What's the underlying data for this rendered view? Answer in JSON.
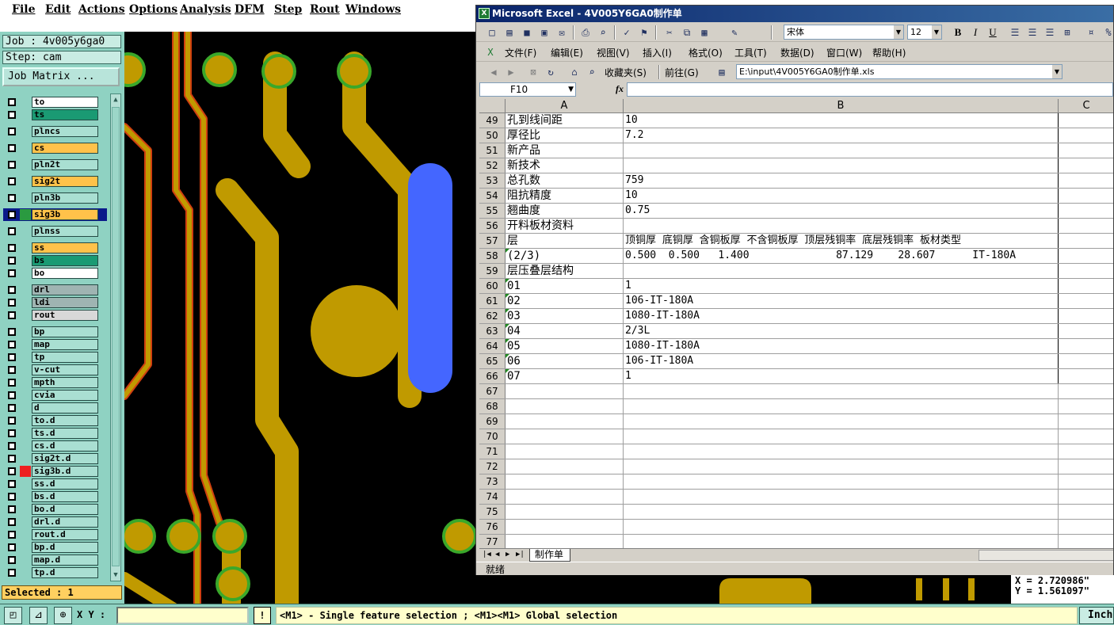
{
  "cam": {
    "menu": [
      "File",
      "Edit",
      "Actions",
      "Options",
      "Analysis",
      "DFM",
      "Step",
      "Rout",
      "Windows"
    ],
    "job_label": "Job : 4v005y6ga0",
    "step_label": "Step: cam",
    "job_matrix": "Job Matrix ...",
    "selected": "Selected : 1",
    "layers": [
      {
        "name": "to",
        "color": "#ffffff"
      },
      {
        "name": "ts",
        "color": "#1a9a73"
      },
      {
        "name": "plncs",
        "color": "#a9dfd2"
      },
      {
        "name": "cs",
        "color": "#ffc24a"
      },
      {
        "name": "pln2t",
        "color": "#a9dfd2"
      },
      {
        "name": "sig2t",
        "color": "#ffc24a"
      },
      {
        "name": "pln3b",
        "color": "#a9dfd2"
      },
      {
        "name": "sig3b",
        "color": "#ffc24a"
      },
      {
        "name": "plnss",
        "color": "#a9dfd2"
      },
      {
        "name": "ss",
        "color": "#ffc24a"
      },
      {
        "name": "bs",
        "color": "#1a9a73"
      },
      {
        "name": "bo",
        "color": "#ffffff"
      },
      {
        "name": "drl",
        "color": "#9fb4b2"
      },
      {
        "name": "ldi",
        "color": "#9fb4b2"
      },
      {
        "name": "rout",
        "color": "#d8d8d8"
      },
      {
        "name": "bp",
        "color": "#a9dfd2"
      },
      {
        "name": "map",
        "color": "#a9dfd2"
      },
      {
        "name": "tp",
        "color": "#a9dfd2"
      },
      {
        "name": "v-cut",
        "color": "#a9dfd2"
      },
      {
        "name": "mpth",
        "color": "#a9dfd2"
      },
      {
        "name": "cvia",
        "color": "#a9dfd2"
      },
      {
        "name": "d",
        "color": "#a9dfd2"
      },
      {
        "name": "to.d",
        "color": "#a9dfd2"
      },
      {
        "name": "ts.d",
        "color": "#a9dfd2"
      },
      {
        "name": "cs.d",
        "color": "#a9dfd2"
      },
      {
        "name": "sig2t.d",
        "color": "#a9dfd2"
      },
      {
        "name": "sig3b.d",
        "color": "#a9dfd2"
      },
      {
        "name": "ss.d",
        "color": "#a9dfd2"
      },
      {
        "name": "bs.d",
        "color": "#a9dfd2"
      },
      {
        "name": "bo.d",
        "color": "#a9dfd2"
      },
      {
        "name": "drl.d",
        "color": "#a9dfd2"
      },
      {
        "name": "rout.d",
        "color": "#a9dfd2"
      },
      {
        "name": "bp.d",
        "color": "#a9dfd2"
      },
      {
        "name": "map.d",
        "color": "#a9dfd2"
      },
      {
        "name": "tp.d",
        "color": "#a9dfd2"
      }
    ],
    "xy_label": "X Y :",
    "warn": "!",
    "status": "<M1> - Single feature selection ; <M1><M1> Global selection",
    "unit": "Inch",
    "coord_x": "X = 2.720986\"",
    "coord_y": "Y = 1.561097\""
  },
  "excel": {
    "title": "Microsoft Excel - 4V005Y6GA0制作单",
    "font_name": "宋体",
    "font_size": "12",
    "menu": [
      "文件(F)",
      "编辑(E)",
      "视图(V)",
      "插入(I)",
      "格式(O)",
      "工具(T)",
      "数据(D)",
      "窗口(W)",
      "帮助(H)"
    ],
    "favorites": "收藏夹(S)",
    "goto": "前往(G)",
    "path": "E:\\input\\4V005Y6GA0制作单.xls",
    "cell_ref": "F10",
    "fx": "fx",
    "columns": [
      "A",
      "B",
      "C"
    ],
    "rows": [
      {
        "n": "49",
        "a": "孔到线间距",
        "b": "10"
      },
      {
        "n": "50",
        "a": "厚径比",
        "b": "7.2"
      },
      {
        "n": "51",
        "a": "新产品",
        "b": ""
      },
      {
        "n": "52",
        "a": "新技术",
        "b": ""
      },
      {
        "n": "53",
        "a": "总孔数",
        "b": "759"
      },
      {
        "n": "54",
        "a": "阻抗精度",
        "b": "10"
      },
      {
        "n": "55",
        "a": "翘曲度",
        "b": "0.75"
      },
      {
        "n": "56",
        "a": "开料板材资料",
        "b": ""
      },
      {
        "n": "57",
        "a": "层",
        "b": "顶铜厚 底铜厚 含铜板厚 不含铜板厚 顶层残铜率 底层残铜率 板材类型"
      },
      {
        "n": "58",
        "a": "(2/3)",
        "b": "0.500  0.500   1.400              87.129    28.607      IT-180A"
      },
      {
        "n": "59",
        "a": "层压叠层结构",
        "b": ""
      },
      {
        "n": "60",
        "a": "01",
        "b": "1"
      },
      {
        "n": "61",
        "a": "02",
        "b": "106-IT-180A"
      },
      {
        "n": "62",
        "a": "03",
        "b": "1080-IT-180A"
      },
      {
        "n": "63",
        "a": "04",
        "b": "2/3L"
      },
      {
        "n": "64",
        "a": "05",
        "b": "1080-IT-180A"
      },
      {
        "n": "65",
        "a": "06",
        "b": "106-IT-180A"
      },
      {
        "n": "66",
        "a": "07",
        "b": "1"
      },
      {
        "n": "67",
        "a": "",
        "b": ""
      },
      {
        "n": "68",
        "a": "",
        "b": ""
      },
      {
        "n": "69",
        "a": "",
        "b": ""
      },
      {
        "n": "70",
        "a": "",
        "b": ""
      },
      {
        "n": "71",
        "a": "",
        "b": ""
      },
      {
        "n": "72",
        "a": "",
        "b": ""
      },
      {
        "n": "73",
        "a": "",
        "b": ""
      },
      {
        "n": "74",
        "a": "",
        "b": ""
      },
      {
        "n": "75",
        "a": "",
        "b": ""
      },
      {
        "n": "76",
        "a": "",
        "b": ""
      },
      {
        "n": "77",
        "a": "",
        "b": ""
      }
    ],
    "sheet_tab": "制作单",
    "status": "就绪"
  },
  "colors": {
    "copper": "#c09a00",
    "pad_ring": "#3aa82a",
    "highlight": "#4466ff",
    "trace_red": "#d04010",
    "cam_panel": "#8fd2c2",
    "cam_status": "#ffffcc",
    "excel_title": "#0a246a"
  }
}
